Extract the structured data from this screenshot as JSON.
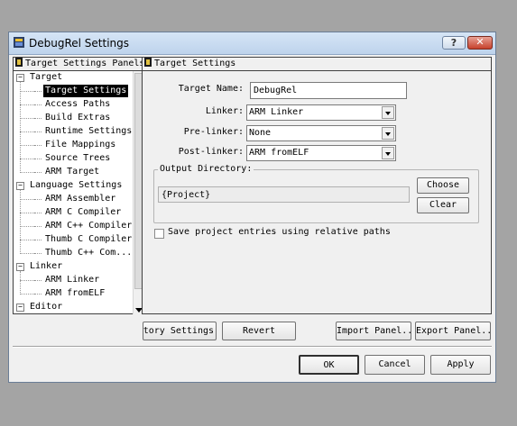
{
  "window": {
    "title": "DebugRel Settings",
    "help_label": "?",
    "close_label": "✕"
  },
  "left_panel": {
    "header": "Target Settings Panels",
    "tree": [
      {
        "label": "Target",
        "group": true,
        "expander": "−"
      },
      {
        "label": "Target Settings",
        "selected": true
      },
      {
        "label": "Access Paths"
      },
      {
        "label": "Build Extras"
      },
      {
        "label": "Runtime Settings"
      },
      {
        "label": "File Mappings"
      },
      {
        "label": "Source Trees"
      },
      {
        "label": "ARM Target"
      },
      {
        "label": "Language Settings",
        "group": true,
        "expander": "−"
      },
      {
        "label": "ARM Assembler"
      },
      {
        "label": "ARM C Compiler"
      },
      {
        "label": "ARM C++ Compiler"
      },
      {
        "label": "Thumb C Compiler"
      },
      {
        "label": "Thumb C++ Com..."
      },
      {
        "label": "Linker",
        "group": true,
        "expander": "−"
      },
      {
        "label": "ARM Linker"
      },
      {
        "label": "ARM fromELF"
      },
      {
        "label": "Editor",
        "group": true,
        "expander": "−"
      }
    ]
  },
  "right_panel": {
    "header": "Target Settings",
    "target_name_label": "Target Name:",
    "target_name_value": "DebugRel",
    "linker_label": "Linker:",
    "linker_value": "ARM Linker",
    "prelinker_label": "Pre-linker:",
    "prelinker_value": "None",
    "postlinker_label": "Post-linker:",
    "postlinker_value": "ARM fromELF",
    "output_dir_label": "Output Directory:",
    "output_dir_value": "{Project}",
    "choose_label": "Choose",
    "clear_label": "Clear",
    "relative_paths_label": "Save project entries using relative paths",
    "relative_paths_checked": false
  },
  "panel_buttons": {
    "factory_settings": "Factory Settings",
    "revert": "Revert",
    "import_panel": "Import Panel...",
    "export_panel": "Export Panel..."
  },
  "dialog_buttons": {
    "ok": "OK",
    "cancel": "Cancel",
    "apply": "Apply"
  }
}
